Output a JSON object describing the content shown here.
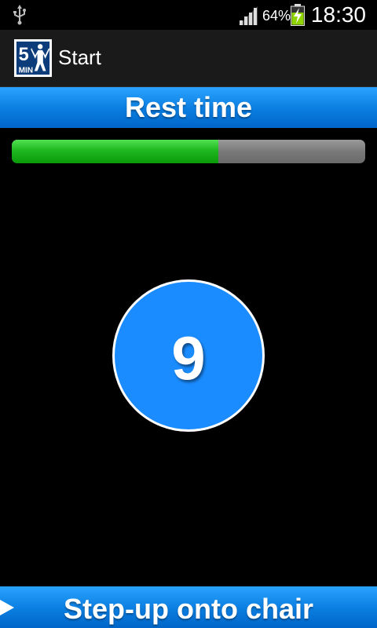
{
  "status_bar": {
    "battery_percent": "64%",
    "time": "18:30",
    "icons": [
      "usb-icon",
      "signal-icon",
      "battery-charging-icon"
    ]
  },
  "action_bar": {
    "logo_text_top": "5",
    "logo_text_bottom": "MIN",
    "title": "Start"
  },
  "header": {
    "title": "Rest time"
  },
  "progress": {
    "fraction": 0.585,
    "fill_color": "#1fb81f",
    "track_color": "#7a7a7a"
  },
  "countdown": {
    "value": "9",
    "color": "#1a8cff"
  },
  "next_exercise": {
    "label": "Step-up onto chair",
    "icon": "play-icon"
  },
  "colors": {
    "accent_blue": "#0a7de0",
    "background": "#000000"
  }
}
